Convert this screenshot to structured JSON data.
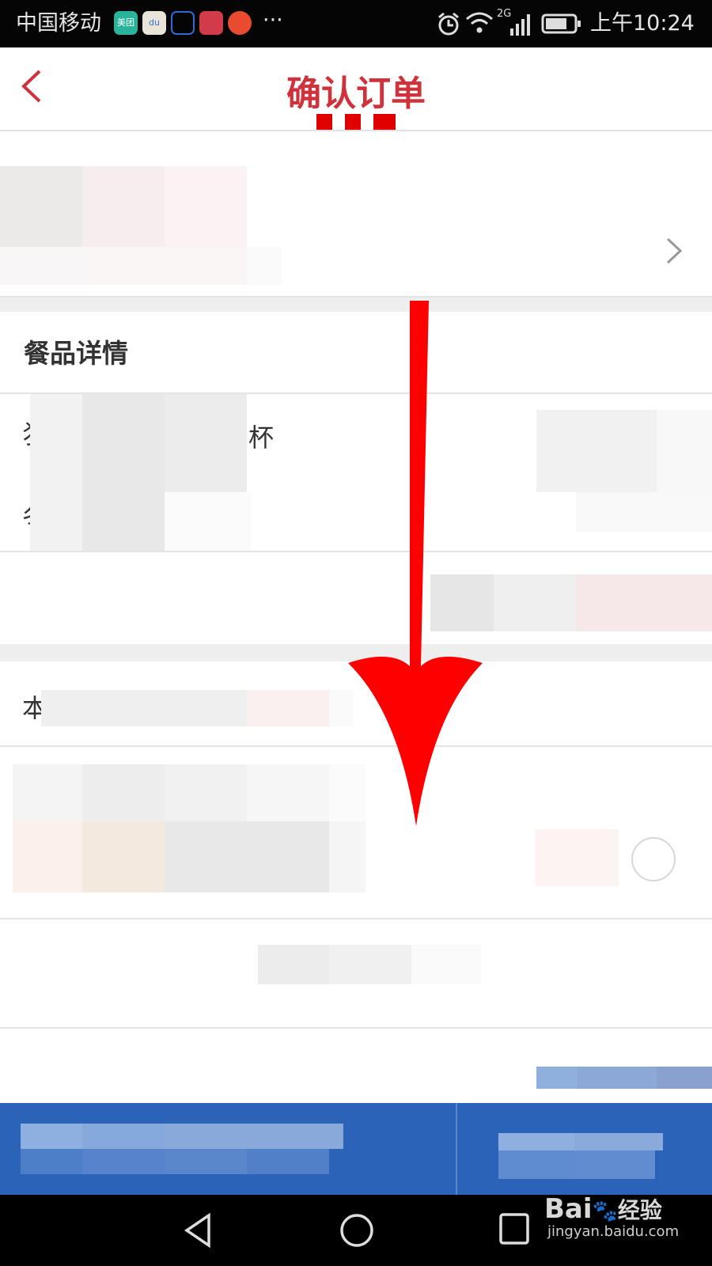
{
  "status_bar": {
    "carrier": "中国移动",
    "apps": [
      "美团",
      "du"
    ],
    "more": "···",
    "network": "2G",
    "time": "上午10:24"
  },
  "header": {
    "title": "确认订单",
    "back_icon": "chevron-left-icon",
    "title_color": "#d0323c"
  },
  "address": {
    "chevron_icon": "chevron-right-icon"
  },
  "details": {
    "title": "餐品详情",
    "item_fragment_1": "杯",
    "item_fragment_2_left": "犭",
    "item_fragment_3_left": "冬"
  },
  "notes": {
    "label_fragment": "本"
  },
  "annotation": {
    "arrow": "arrow-down-icon",
    "color": "#ff0000"
  },
  "bottom_bar": {
    "color": "#2a63b8"
  },
  "watermark": {
    "logo": "Bai",
    "logo_suffix": "经验",
    "url": "jingyan.baidu.com"
  }
}
